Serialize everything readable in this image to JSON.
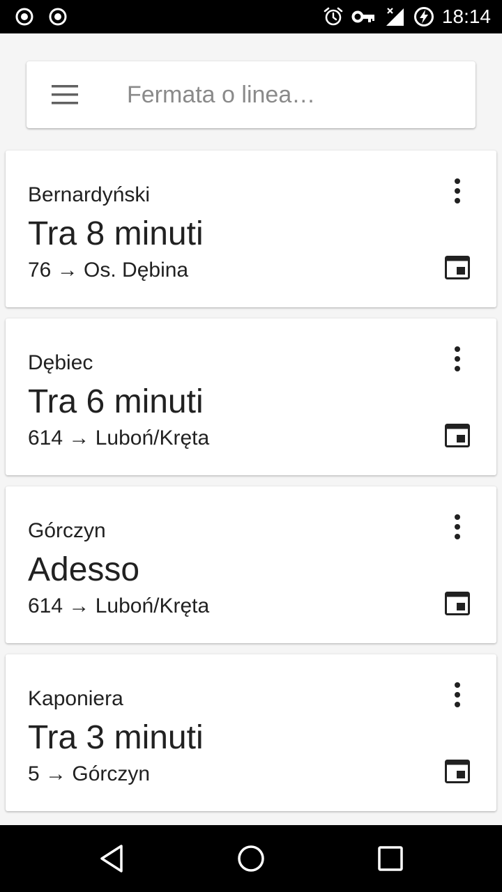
{
  "status_bar": {
    "time": "18:14",
    "left_icons": [
      "record-icon",
      "record-icon"
    ],
    "right_icons": [
      "alarm-icon",
      "vpn-key-icon",
      "signal-off-icon",
      "battery-charging-icon"
    ]
  },
  "search": {
    "placeholder": "Fermata o linea…",
    "value": ""
  },
  "cards": [
    {
      "stop": "Bernardyński",
      "eta": "Tra 8 minuti",
      "route": "76 → Os. Dębina"
    },
    {
      "stop": "Dębiec",
      "eta": "Tra 6 minuti",
      "route": "614 → Luboń/Kręta"
    },
    {
      "stop": "Górczyn",
      "eta": "Adesso",
      "route": "614 → Luboń/Kręta"
    },
    {
      "stop": "Kaponiera",
      "eta": "Tra 3 minuti",
      "route": "5 → Górczyn"
    }
  ],
  "colors": {
    "background": "#f5f5f5",
    "card": "#ffffff",
    "text": "#212121",
    "placeholder": "#8a8a8a",
    "system_bars": "#000000"
  }
}
